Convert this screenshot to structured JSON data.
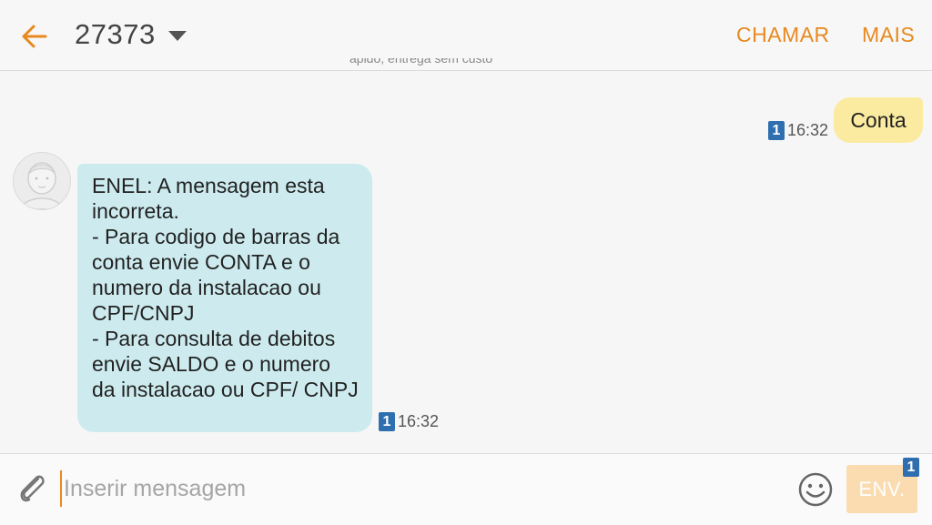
{
  "header": {
    "contact_number": "27373",
    "call_label": "CHAMAR",
    "more_label": "MAIS"
  },
  "conversation": {
    "clipped_previous_text": "ápido, entrega sem custo",
    "outgoing": {
      "text": "Conta",
      "time": "16:32",
      "sim": "1"
    },
    "incoming": {
      "text": "ENEL: A mensagem  esta incorreta.\n- Para codigo de barras da conta envie CONTA e o numero da instalacao ou CPF/CNPJ\n- Para consulta de debitos envie SALDO e o numero da instalacao ou CPF/ CNPJ",
      "time": "16:32",
      "sim": "1"
    }
  },
  "composer": {
    "placeholder": "Inserir mensagem",
    "value": "",
    "send_label": "ENV.",
    "send_sim": "1"
  },
  "colors": {
    "accent": "#e8891f",
    "outgoing_bubble": "#fbeba0",
    "incoming_bubble": "#cdebef",
    "sim_badge": "#2f6fb0",
    "send_button": "#fbdcb0"
  },
  "icons": {
    "back": "arrow-left-icon",
    "dropdown": "caret-down-icon",
    "attach": "paperclip-icon",
    "emoji": "smiley-icon",
    "avatar": "person-avatar-icon"
  }
}
